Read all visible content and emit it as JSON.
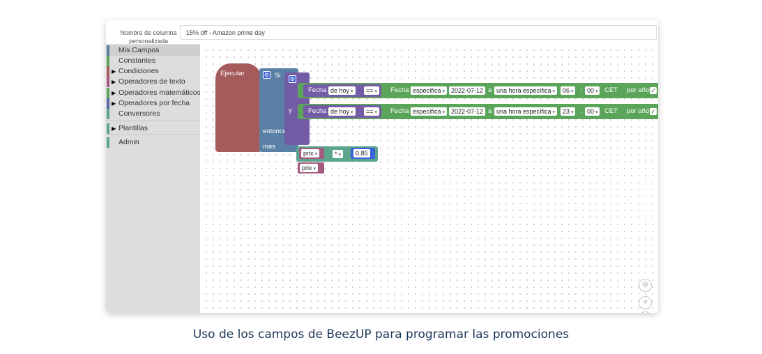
{
  "header": {
    "field_label": "Nombre de columna personalizada",
    "field_value": "15% off - Amazon prime day"
  },
  "sidebar": {
    "categories": [
      {
        "label": "Mis Campos",
        "color": "#5b80a5",
        "has_children": false
      },
      {
        "label": "Constantes",
        "color": "#5ba55b",
        "has_children": false
      },
      {
        "label": "Condiciones",
        "color": "#a55b5b",
        "has_children": true
      },
      {
        "label": "Operadores de texto",
        "color": "#a55b80",
        "has_children": true
      },
      {
        "label": "Operadores matemáticos",
        "color": "#5ba55b",
        "has_children": true
      },
      {
        "label": "Operadores por fecha",
        "color": "#5b67a5",
        "has_children": true
      },
      {
        "label": "Conversores",
        "color": "#5ba58c",
        "has_children": false
      },
      {
        "label": "Plantillas",
        "color": "#5ba58c",
        "has_children": true
      },
      {
        "label": "Admin",
        "color": "#5ba58c",
        "has_children": false
      }
    ]
  },
  "blocks": {
    "execute": "Ejecutar",
    "if": "Si",
    "and": "y",
    "then": "entonces",
    "else": "más",
    "conditions": [
      {
        "fecha": "Fecha",
        "de_hoy": "de hoy",
        "op": "==",
        "fecha2": "Fecha",
        "especifica": "específica",
        "date": "2022-07-12",
        "a": "a",
        "hora": "una hora específica",
        "hour": "06",
        "colon": ":",
        "minute": "00",
        "tz": "CET",
        "por_ano": "por año",
        "checked": true
      },
      {
        "fecha": "Fecha",
        "de_hoy": "de hoy",
        "op": "==",
        "fecha2": "Fecha",
        "especifica": "específica",
        "date": "2022-07-12",
        "a": "a",
        "hora": "una hora específica",
        "hour": "23",
        "colon": ":",
        "minute": "00",
        "tz": "CET",
        "por_ano": "por año",
        "checked": true
      }
    ],
    "then_expr": {
      "field": "prix",
      "op": "*",
      "value": "0.85"
    },
    "else_expr": {
      "field": "prix"
    }
  },
  "colors": {
    "control": "#a55b5b",
    "if": "#5b80a5",
    "logic": "#745ba5",
    "date": "#5ba55b",
    "math": "#5ba58c",
    "field": "#a55b80"
  },
  "icons": {
    "gear": "gear-icon",
    "check": "check-icon",
    "recenter": "target-icon",
    "zoom_in": "plus-icon",
    "zoom_out": "minus-icon"
  },
  "caption": "Uso de los campos de BeezUP para programar las promociones"
}
